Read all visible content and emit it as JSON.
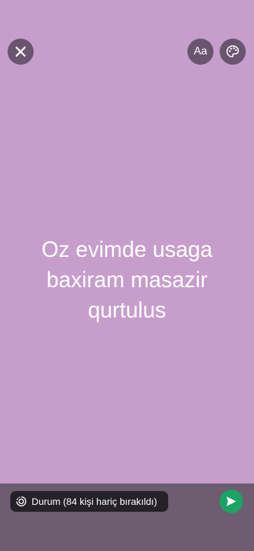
{
  "colors": {
    "background": "#c79ecb",
    "top_buttons": "#6a5570",
    "bottom_bar": "#6d5d70",
    "audience_pill": "#242128",
    "send_button": "#1aa363",
    "text": "#ffffff"
  },
  "toolbar": {
    "close_icon": "close-icon",
    "font_label": "Aa",
    "palette_icon": "palette-icon"
  },
  "status": {
    "text": "Oz evimde usaga baxiram masazir qurtulus"
  },
  "footer": {
    "audience_label": "Durum (84 kişi hariç bırakıldı)",
    "audience_icon": "status-ring-icon",
    "send_icon": "send-icon"
  }
}
